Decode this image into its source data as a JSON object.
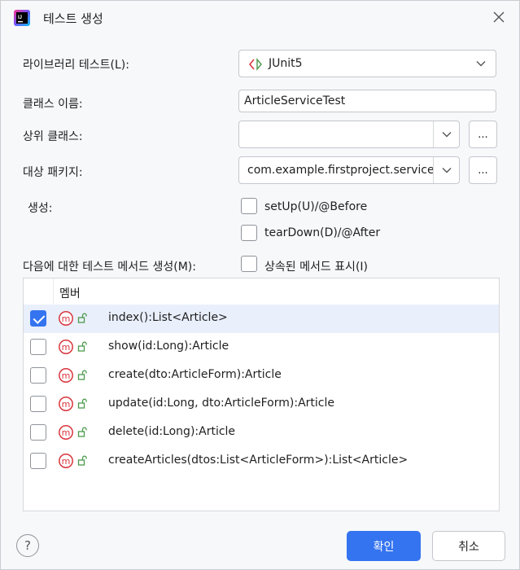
{
  "window": {
    "title": "테스트 생성"
  },
  "form": {
    "library": {
      "label": "라이브러리 테스트(L):",
      "value": "JUnit5"
    },
    "class_name": {
      "label": "클래스 이름:",
      "value": "ArticleServiceTest"
    },
    "superclass": {
      "label": "상위 클래스:",
      "value": "",
      "browse": "..."
    },
    "package": {
      "label": "대상 패키지:",
      "value": "com.example.firstproject.service",
      "browse": "..."
    },
    "generate": {
      "label": "생성:",
      "setup": "setUp(U)/@Before",
      "teardown": "tearDown(D)/@After"
    },
    "methods_for": {
      "label": "다음에 대한 테스트 메서드 생성(M):",
      "inherited": "상속된 메서드 표시(I)"
    }
  },
  "members": {
    "header": "멤버",
    "rows": [
      {
        "text": "index():List<Article>",
        "checked": true
      },
      {
        "text": "show(id:Long):Article",
        "checked": false
      },
      {
        "text": "create(dto:ArticleForm):Article",
        "checked": false
      },
      {
        "text": "update(id:Long, dto:ArticleForm):Article",
        "checked": false
      },
      {
        "text": "delete(id:Long):Article",
        "checked": false
      },
      {
        "text": "createArticles(dtos:List<ArticleForm>):List<Article>",
        "checked": false
      }
    ]
  },
  "buttons": {
    "help": "?",
    "ok": "확인",
    "cancel": "취소"
  },
  "colors": {
    "accent": "#3574f0",
    "method_icon": "#d9363e",
    "lock_icon": "#4c9a4c"
  }
}
